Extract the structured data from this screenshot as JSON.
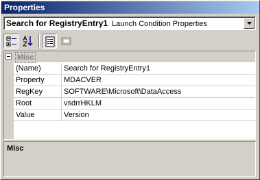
{
  "window": {
    "title": "Properties"
  },
  "object_selector": {
    "name": "Search for RegistryEntry1",
    "type": "Launch Condition Properties"
  },
  "toolbar": {
    "buttons": [
      {
        "name": "categorized-button",
        "icon": "categorized-icon",
        "pressed": true
      },
      {
        "name": "alphabetical-button",
        "icon": "alphabetical-icon",
        "pressed": false
      },
      {
        "name": "properties-button",
        "icon": "properties-icon",
        "pressed": true
      },
      {
        "name": "property-pages-button",
        "icon": "property-pages-icon",
        "pressed": false
      }
    ]
  },
  "grid": {
    "category": "Misc",
    "rows": [
      {
        "name": "(Name)",
        "value": "Search for RegistryEntry1"
      },
      {
        "name": "Property",
        "value": "MDACVER"
      },
      {
        "name": "RegKey",
        "value": "SOFTWARE\\Microsoft\\DataAccess"
      },
      {
        "name": "Root",
        "value": "vsdrrHKLM"
      },
      {
        "name": "Value",
        "value": "Version"
      }
    ]
  },
  "description": {
    "title": "Misc"
  },
  "colors": {
    "titlebar_start": "#0a246a",
    "titlebar_end": "#a6caf0",
    "face": "#d4d0c8"
  }
}
